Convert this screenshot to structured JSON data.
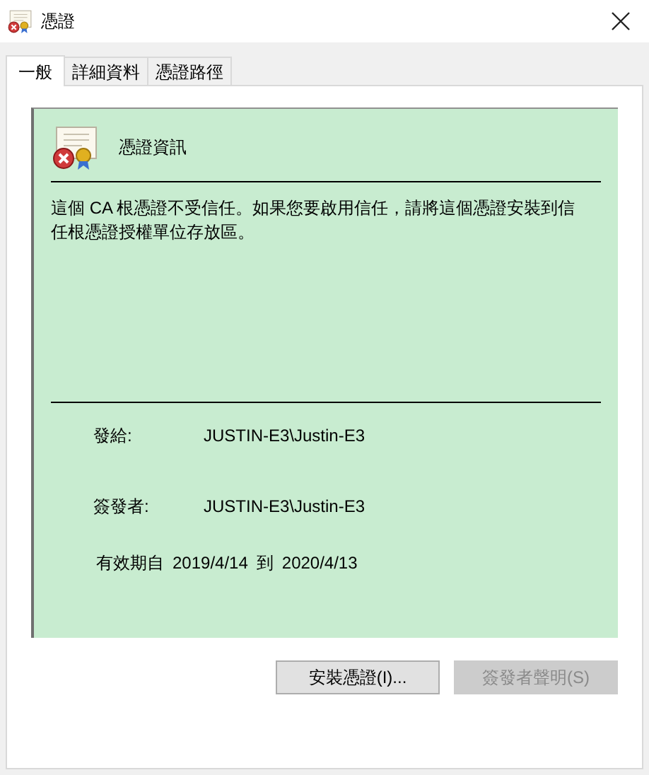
{
  "window": {
    "title": "憑證"
  },
  "tabs": [
    {
      "label": "一般",
      "selected": true
    },
    {
      "label": "詳細資料",
      "selected": false
    },
    {
      "label": "憑證路徑",
      "selected": false
    }
  ],
  "info": {
    "heading": "憑證資訊",
    "message": "這個 CA 根憑證不受信任。如果您要啟用信任，請將這個憑證安裝到信任根憑證授權單位存放區。",
    "fields": [
      {
        "label": "發給:",
        "value": "JUSTIN-E3\\Justin-E3"
      },
      {
        "label": "簽發者:",
        "value": "JUSTIN-E3\\Justin-E3"
      }
    ],
    "validity": {
      "from_label": "有效期自",
      "from": "2019/4/14",
      "to_label": "到",
      "to": "2020/4/13"
    }
  },
  "buttons": [
    {
      "label": "安裝憑證(I)...",
      "disabled": false
    },
    {
      "label": "簽發者聲明(S)",
      "disabled": true
    }
  ]
}
